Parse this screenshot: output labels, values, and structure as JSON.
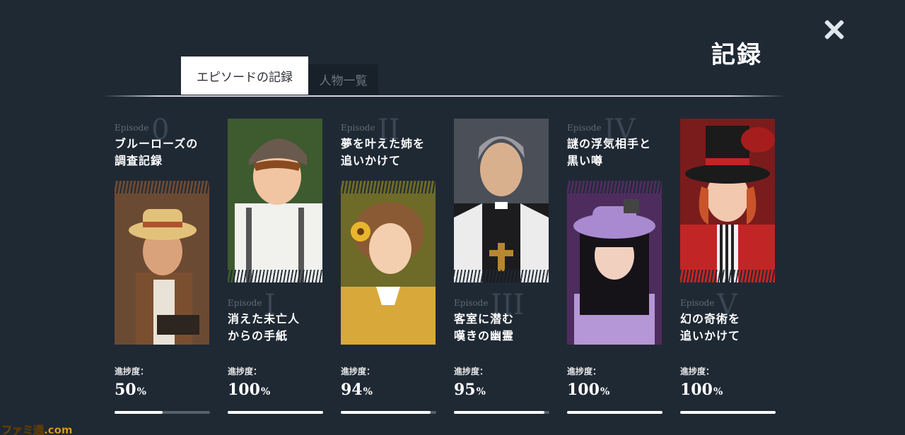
{
  "header": {
    "title": "記録",
    "close_icon": "close-icon"
  },
  "tabs": [
    {
      "label": "エピソードの記録",
      "active": true
    },
    {
      "label": "人物一覧",
      "active": false
    }
  ],
  "episodes": [
    {
      "word": "Episode",
      "numeral": "0",
      "title": "ブルーローズの\n調査記録",
      "progress_label": "進捗度：",
      "progress_value": "50",
      "unit": "%",
      "progress": 0.5,
      "portrait": "man-straw-hat-portrait",
      "bg": "#6b4a34"
    },
    {
      "word": "Episode",
      "numeral": "I",
      "title": "消えた未亡人\nからの手紙",
      "progress_label": "進捗度：",
      "progress_value": "100",
      "unit": "%",
      "progress": 1.0,
      "portrait": "boy-flat-cap-portrait",
      "bg": "#3e5a2f"
    },
    {
      "word": "Episode",
      "numeral": "II",
      "title": "夢を叶えた姉を\n追いかけて",
      "progress_label": "進捗度：",
      "progress_value": "94",
      "unit": "%",
      "progress": 0.94,
      "portrait": "girl-yellow-flower-portrait",
      "bg": "#6e6a28"
    },
    {
      "word": "Episode",
      "numeral": "III",
      "title": "客室に潜む\n嘆きの幽霊",
      "progress_label": "進捗度：",
      "progress_value": "95",
      "unit": "%",
      "progress": 0.95,
      "portrait": "priest-portrait",
      "bg": "#4a4f58"
    },
    {
      "word": "Episode",
      "numeral": "IV",
      "title": "謎の浮気相手と\n黒い噂",
      "progress_label": "進捗度：",
      "progress_value": "100",
      "unit": "%",
      "progress": 1.0,
      "portrait": "woman-purple-hat-portrait",
      "bg": "#4e2d5e"
    },
    {
      "word": "Episode",
      "numeral": "V",
      "title": "幻の奇術を\n追いかけて",
      "progress_label": "進捗度：",
      "progress_value": "100",
      "unit": "%",
      "progress": 1.0,
      "portrait": "magician-woman-portrait",
      "bg": "#7a1c1c"
    }
  ],
  "watermark": "ファミ通.com"
}
